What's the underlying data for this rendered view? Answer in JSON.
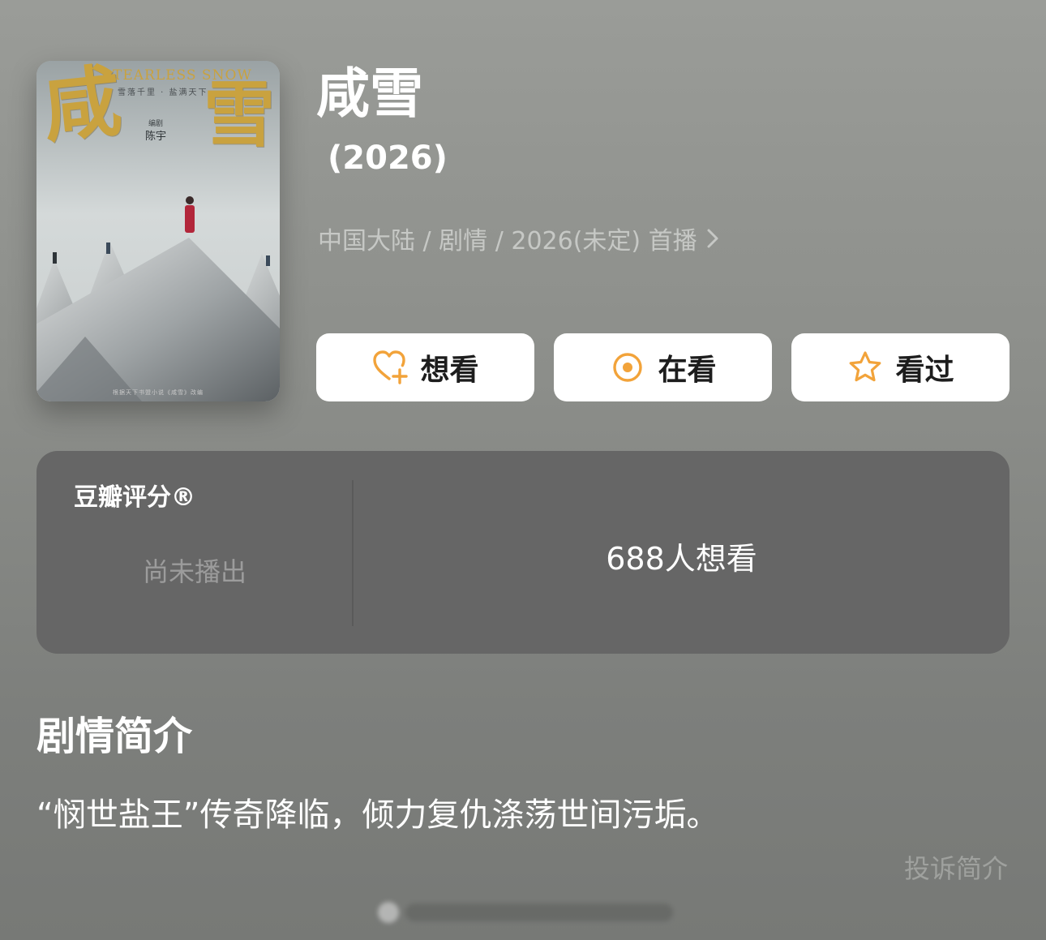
{
  "poster": {
    "title_glyph_left": "咸",
    "title_glyph_right": "雪",
    "english_title": "TEARLESS SNOW",
    "tagline": "雪落千里 · 盐满天下",
    "credit_role": "编剧",
    "credit_name": "陈宇",
    "footer": "根据天下书盟小说《咸雪》改编"
  },
  "show": {
    "title": "咸雪",
    "year": "(2026)",
    "meta": "中国大陆 / 剧情 / 2026(未定) 首播"
  },
  "actions": {
    "want": "想看",
    "watching": "在看",
    "watched": "看过"
  },
  "rating": {
    "label": "豆瓣评分®",
    "status": "尚未播出",
    "want_count": "688人想看"
  },
  "synopsis": {
    "heading": "剧情简介",
    "text": "“悯世盐王”传奇降临，倾力复仇涤荡世间污垢。",
    "report_link": "投诉简介"
  },
  "colors": {
    "accent": "#f2a33a",
    "card": "#666666",
    "meta_text": "#c6c8c5"
  }
}
